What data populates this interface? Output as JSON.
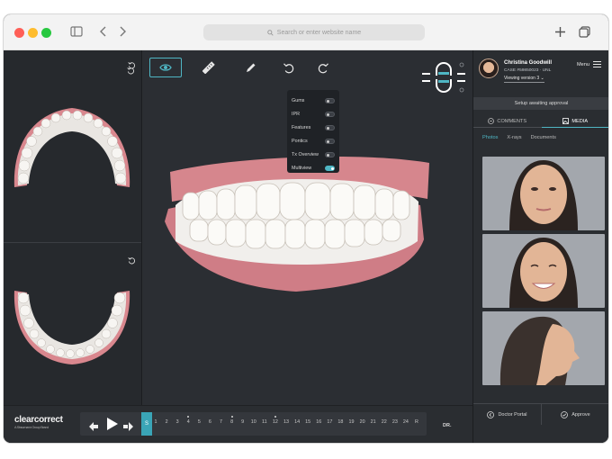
{
  "browser": {
    "address_placeholder": "Search or enter website name"
  },
  "toolbar": {
    "tools": [
      "eye-icon",
      "ruler-icon",
      "pencil-icon",
      "undo-icon",
      "redo-icon"
    ]
  },
  "visibility_menu": {
    "items": [
      {
        "label": "Gums",
        "on": false
      },
      {
        "label": "IPR",
        "on": false
      },
      {
        "label": "Features",
        "on": false
      },
      {
        "label": "Pontics",
        "on": false
      },
      {
        "label": "Tx Overview",
        "on": false
      },
      {
        "label": "Multiview",
        "on": true
      }
    ]
  },
  "patient": {
    "name": "Christina Goodwill",
    "case": "CASE #59850023 · UNL",
    "version": "Viewing version 3",
    "menu_label": "Menu"
  },
  "status": "Setup awaiting approval",
  "tabs": {
    "comments": "COMMENTS",
    "media": "MEDIA"
  },
  "subtabs": [
    "Photos",
    "X-rays",
    "Documents"
  ],
  "actions": {
    "portal": "Doctor Portal",
    "approve": "Approve"
  },
  "brand": {
    "name": "clearcorrect",
    "tagline": "A Straumann Group Brand"
  },
  "timeline": {
    "current": "S",
    "stages": [
      "1",
      "2",
      "3",
      "4",
      "5",
      "6",
      "7",
      "8",
      "9",
      "10",
      "11",
      "12",
      "13",
      "14",
      "15",
      "16",
      "17",
      "18",
      "19",
      "20",
      "21",
      "22",
      "23",
      "24",
      "R"
    ],
    "dotted": [
      "4",
      "8",
      "12"
    ],
    "end_label": "DR."
  },
  "colors": {
    "accent": "#4fb6c4",
    "background": "#2c2f33"
  }
}
